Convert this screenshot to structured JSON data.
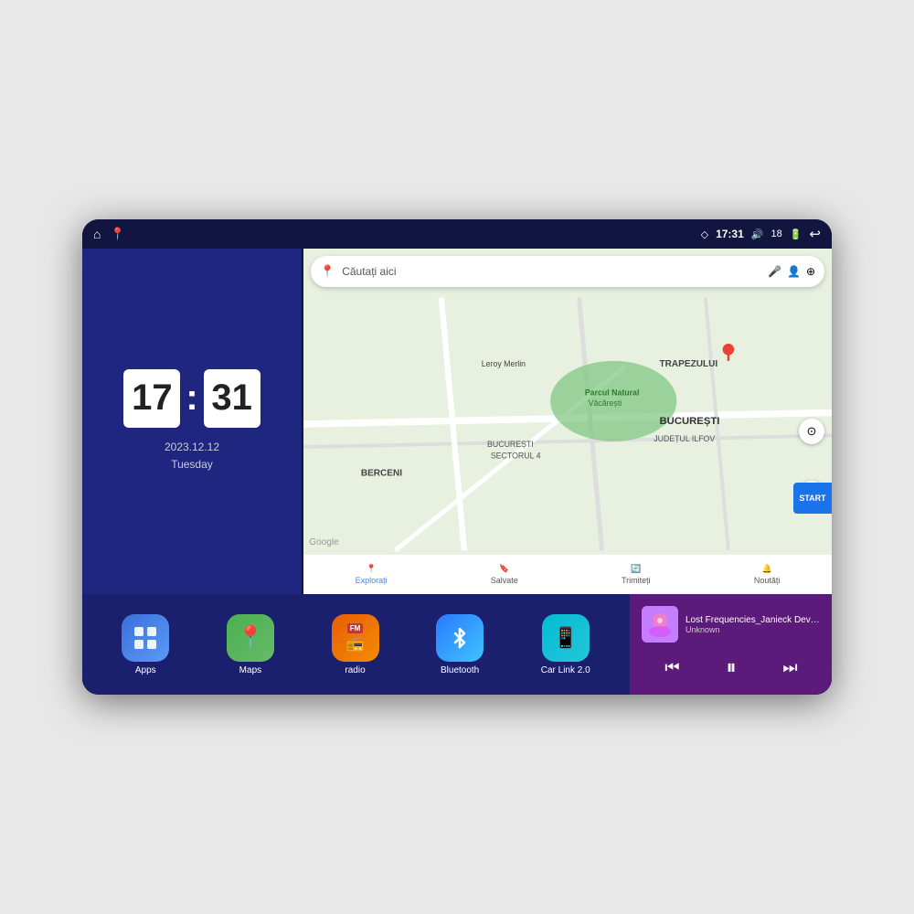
{
  "device": {
    "status_bar": {
      "location_icon": "◇",
      "time": "17:31",
      "volume_icon": "🔊",
      "battery_level": "18",
      "battery_icon": "🔋",
      "back_icon": "↩"
    },
    "clock": {
      "hour": "17",
      "minute": "31",
      "date": "2023.12.12",
      "day": "Tuesday"
    },
    "map": {
      "search_placeholder": "Căutați aici",
      "bottom_nav": [
        {
          "id": "explorați",
          "label": "Explorați",
          "icon": "📍"
        },
        {
          "id": "salvate",
          "label": "Salvate",
          "icon": "🔖"
        },
        {
          "id": "trimiteți",
          "label": "Trimiteți",
          "icon": "🔄"
        },
        {
          "id": "noutăți",
          "label": "Noutăți",
          "icon": "🔔"
        }
      ],
      "location_names": [
        "Parcul Natural Văcărești",
        "BUCUREȘTI",
        "JUDEȚUL ILFOV",
        "TRAPEZULUI",
        "Leroy Merlin",
        "BERCENI",
        "BUCUREȘTI SECTORUL 4"
      ]
    },
    "apps": [
      {
        "id": "apps",
        "label": "Apps",
        "icon": "⊞",
        "color_class": "icon-apps"
      },
      {
        "id": "maps",
        "label": "Maps",
        "icon": "📍",
        "color_class": "icon-maps"
      },
      {
        "id": "radio",
        "label": "radio",
        "icon": "📻",
        "color_class": "icon-radio"
      },
      {
        "id": "bluetooth",
        "label": "Bluetooth",
        "icon": "⚡",
        "color_class": "icon-bluetooth"
      },
      {
        "id": "carlink",
        "label": "Car Link 2.0",
        "icon": "📱",
        "color_class": "icon-carlink"
      }
    ],
    "music": {
      "title": "Lost Frequencies_Janieck Devy-...",
      "artist": "Unknown",
      "prev_icon": "⏮",
      "play_icon": "⏸",
      "next_icon": "⏭"
    }
  }
}
